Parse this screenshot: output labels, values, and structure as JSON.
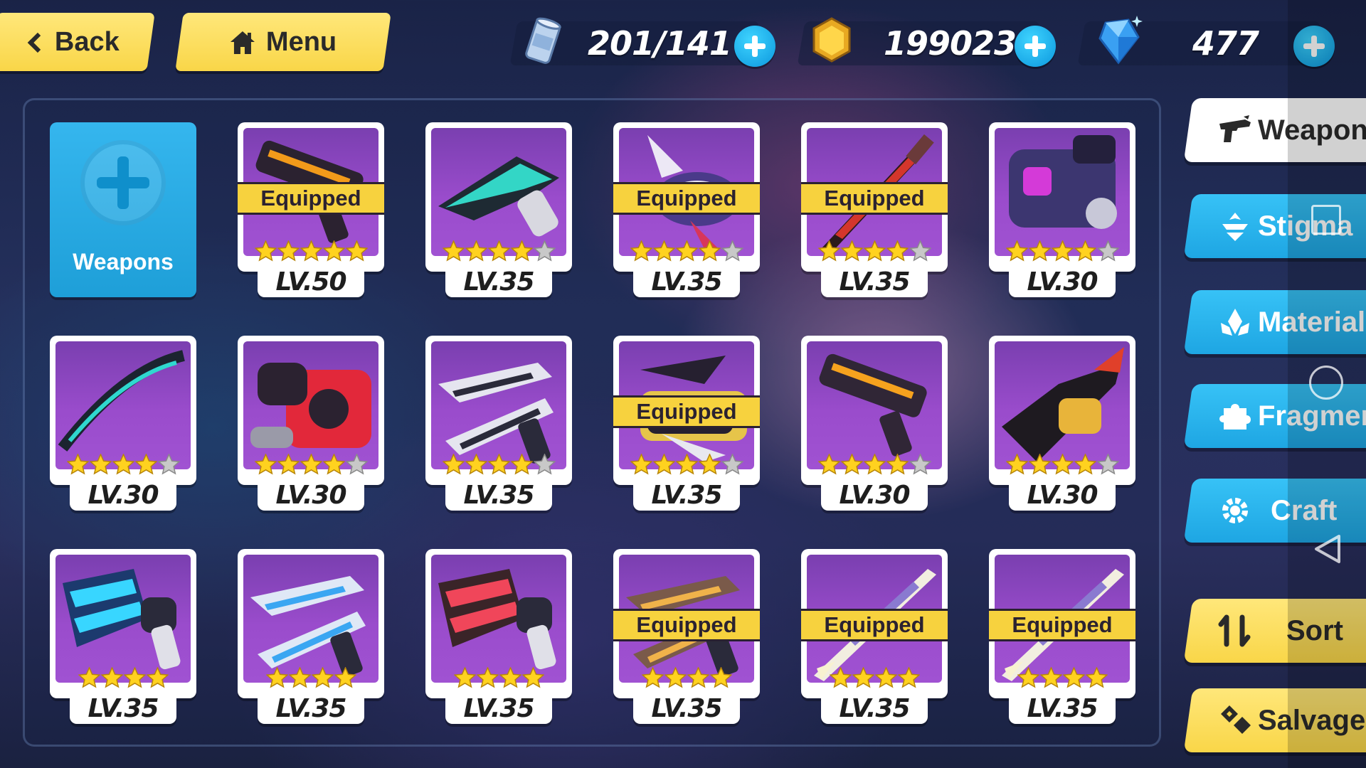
{
  "header": {
    "back_label": "Back",
    "menu_label": "Menu"
  },
  "resources": {
    "stamina": "201/141",
    "coins": "199023",
    "crystals": "477"
  },
  "add_card": {
    "label": "Weapons"
  },
  "equipped_label": "Equipped",
  "weapons": [
    {
      "level": "LV.50",
      "stars": 5,
      "max_stars": 5,
      "equipped": true,
      "art": "dark-cannon"
    },
    {
      "level": "LV.35",
      "stars": 4,
      "max_stars": 5,
      "equipped": false,
      "art": "teal-blade-gun"
    },
    {
      "level": "LV.35",
      "stars": 4,
      "max_stars": 5,
      "equipped": true,
      "art": "white-wing-gun"
    },
    {
      "level": "LV.35",
      "stars": 4,
      "max_stars": 5,
      "equipped": true,
      "art": "red-katana"
    },
    {
      "level": "LV.30",
      "stars": 4,
      "max_stars": 5,
      "equipped": false,
      "art": "purple-gauntlet"
    },
    {
      "level": "LV.30",
      "stars": 4,
      "max_stars": 5,
      "equipped": false,
      "art": "teal-bow"
    },
    {
      "level": "LV.30",
      "stars": 4,
      "max_stars": 5,
      "equipped": false,
      "art": "red-fist"
    },
    {
      "level": "LV.35",
      "stars": 4,
      "max_stars": 5,
      "equipped": false,
      "art": "silver-pistols"
    },
    {
      "level": "LV.35",
      "stars": 4,
      "max_stars": 5,
      "equipped": true,
      "art": "black-gold-claw"
    },
    {
      "level": "LV.30",
      "stars": 4,
      "max_stars": 5,
      "equipped": false,
      "art": "orange-cannon"
    },
    {
      "level": "LV.30",
      "stars": 4,
      "max_stars": 5,
      "equipped": false,
      "art": "gold-gauntlet"
    },
    {
      "level": "LV.35",
      "stars": 4,
      "max_stars": 4,
      "equipped": false,
      "art": "blue-revolver"
    },
    {
      "level": "LV.35",
      "stars": 4,
      "max_stars": 4,
      "equipped": false,
      "art": "blue-white-pistols"
    },
    {
      "level": "LV.35",
      "stars": 4,
      "max_stars": 4,
      "equipped": false,
      "art": "red-revolver"
    },
    {
      "level": "LV.35",
      "stars": 4,
      "max_stars": 4,
      "equipped": true,
      "art": "bronze-pistols"
    },
    {
      "level": "LV.35",
      "stars": 4,
      "max_stars": 4,
      "equipped": true,
      "art": "white-katana"
    },
    {
      "level": "LV.35",
      "stars": 4,
      "max_stars": 4,
      "equipped": true,
      "art": "white-katana"
    }
  ],
  "side_tabs": {
    "weapon": "Weapon",
    "stigma": "Stigma",
    "material": "Material",
    "fragment": "Fragment",
    "craft": "Craft",
    "sort": "Sort",
    "salvage": "Salvage"
  },
  "colors": {
    "accent_yellow": "#f9d648",
    "accent_blue": "#1ea6e3",
    "card_purple": "#9a4ccc",
    "star_gold": "#ffd21f",
    "star_empty": "#c8c8c8"
  }
}
